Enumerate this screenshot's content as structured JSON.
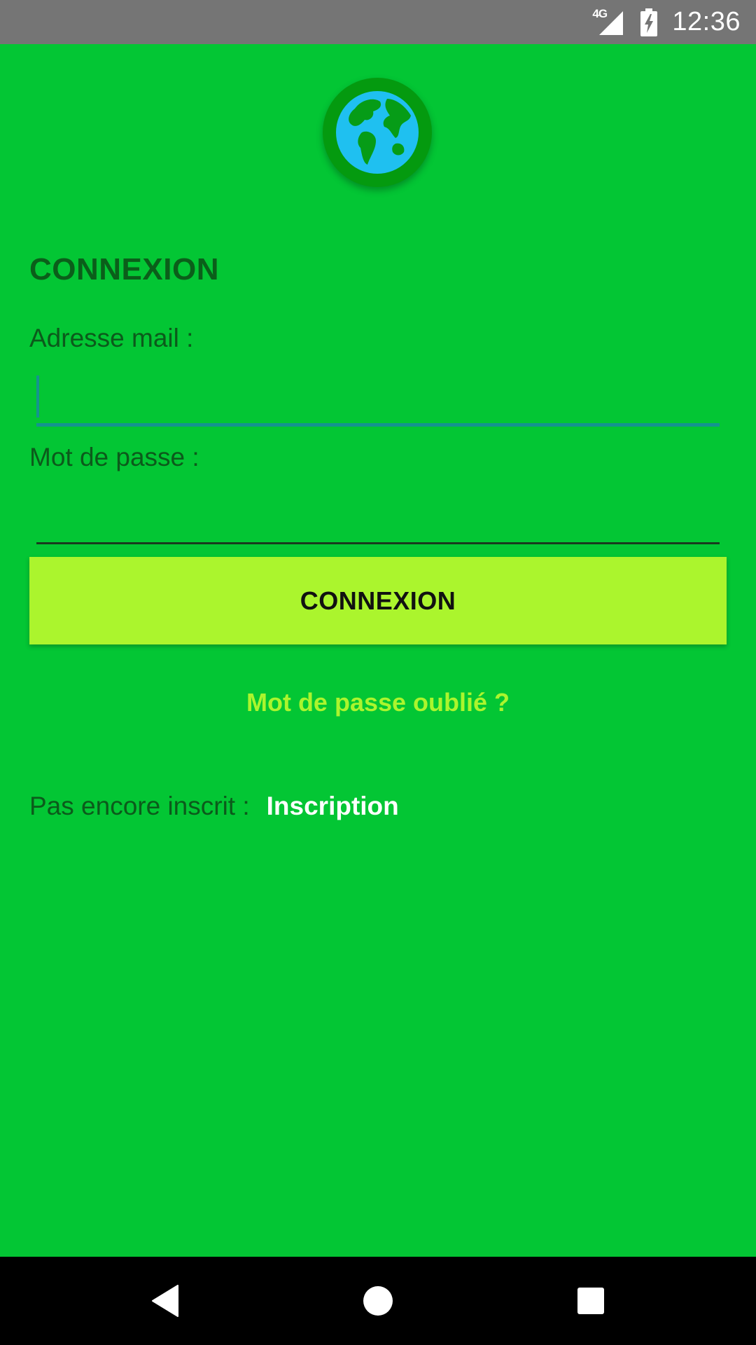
{
  "status_bar": {
    "network_label": "4G",
    "time": "12:36",
    "icons": [
      "signal-icon",
      "battery-charging-icon"
    ]
  },
  "app": {
    "logo_icon": "globe-icon",
    "title": "CONNEXION",
    "email_label": "Adresse mail :",
    "email_value": "",
    "password_label": "Mot de passe :",
    "password_value": "",
    "login_button": "CONNEXION",
    "forgot_password": "Mot de passe oublié ?",
    "register_prompt": "Pas encore inscrit :",
    "register_link": "Inscription"
  },
  "nav_bar": {
    "icons": [
      "back-icon",
      "home-icon",
      "recent-apps-icon"
    ]
  },
  "colors": {
    "background": "#03c634",
    "button": "#abf52d",
    "link": "#abf52d",
    "title": "#0b5e1a",
    "field_focus": "#14948f",
    "status_bar": "#757575",
    "nav_bar": "#000000"
  }
}
